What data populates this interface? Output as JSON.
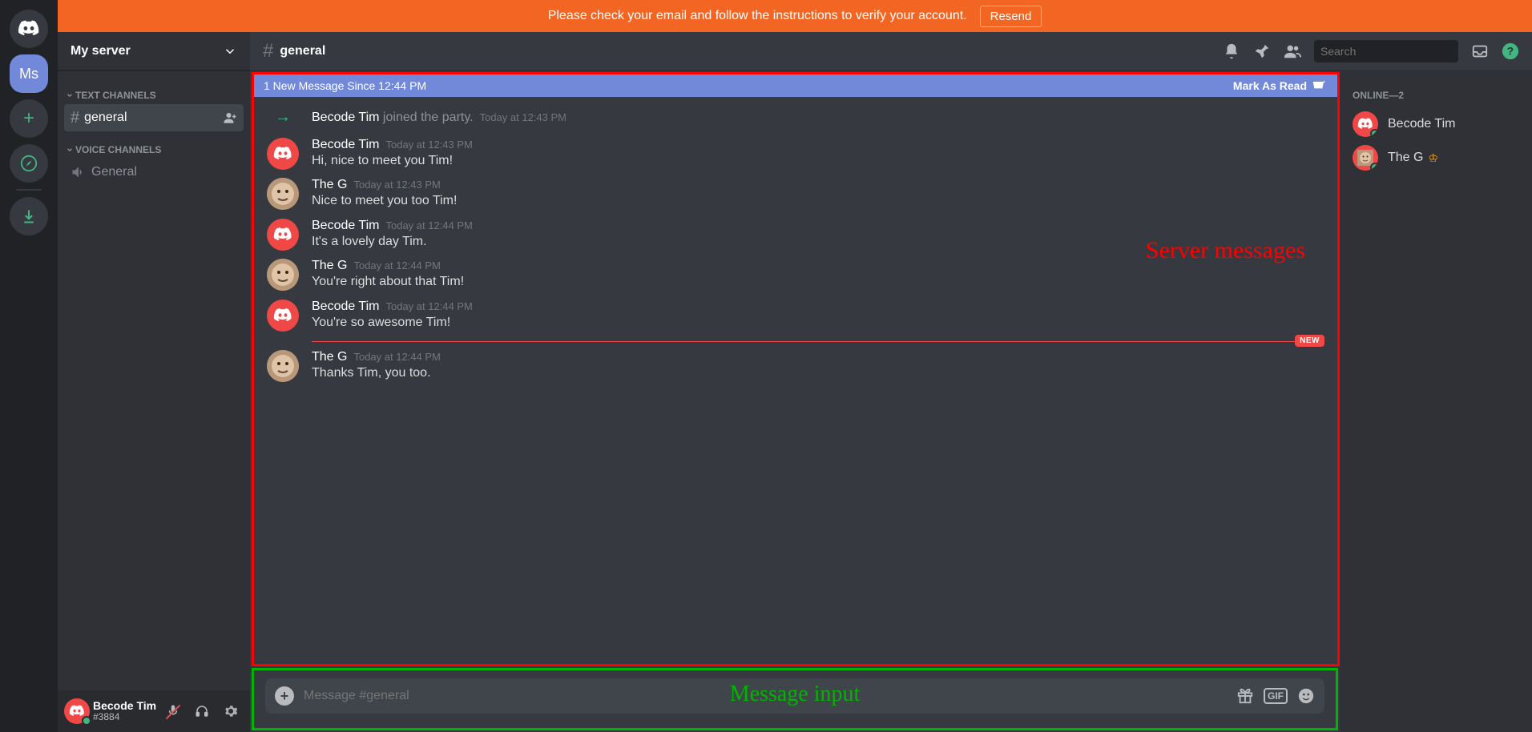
{
  "banner": {
    "text": "Please check your email and follow the instructions to verify your account.",
    "button": "Resend"
  },
  "server": {
    "name": "My server",
    "initials": "Ms"
  },
  "categories": {
    "text": "TEXT CHANNELS",
    "voice": "VOICE CHANNELS"
  },
  "channels": {
    "text": "general",
    "voice": "General"
  },
  "current_channel": "general",
  "search_placeholder": "Search",
  "new_bar": {
    "text": "1 New Message Since 12:44 PM",
    "mark": "Mark As Read"
  },
  "annotations": {
    "messages": "Server messages",
    "input": "Message input"
  },
  "system_message": {
    "user": "Becode Tim",
    "action": " joined the party.",
    "timestamp": "Today at 12:43 PM"
  },
  "messages": [
    {
      "author": "Becode Tim",
      "avatar": "discord",
      "timestamp": "Today at 12:43 PM",
      "text": "Hi, nice to meet you Tim!"
    },
    {
      "author": "The G",
      "avatar": "face",
      "timestamp": "Today at 12:43 PM",
      "text": "Nice to meet you too Tim!"
    },
    {
      "author": "Becode Tim",
      "avatar": "discord",
      "timestamp": "Today at 12:44 PM",
      "text": "It's a lovely day Tim."
    },
    {
      "author": "The G",
      "avatar": "face",
      "timestamp": "Today at 12:44 PM",
      "text": "You're right about that Tim!"
    },
    {
      "author": "Becode Tim",
      "avatar": "discord",
      "timestamp": "Today at 12:44 PM",
      "text": "You're so awesome Tim!"
    },
    {
      "author": "The G",
      "avatar": "face",
      "timestamp": "Today at 12:44 PM",
      "text": "Thanks Tim, you too."
    }
  ],
  "new_divider_after": 4,
  "new_badge": "NEW",
  "input_placeholder": "Message #general",
  "members_header": "ONLINE—2",
  "members": [
    {
      "name": "Becode Tim",
      "avatar": "discord",
      "owner": false
    },
    {
      "name": "The G",
      "avatar": "face",
      "owner": true
    }
  ],
  "me": {
    "name": "Becode Tim",
    "tag": "#3884"
  }
}
